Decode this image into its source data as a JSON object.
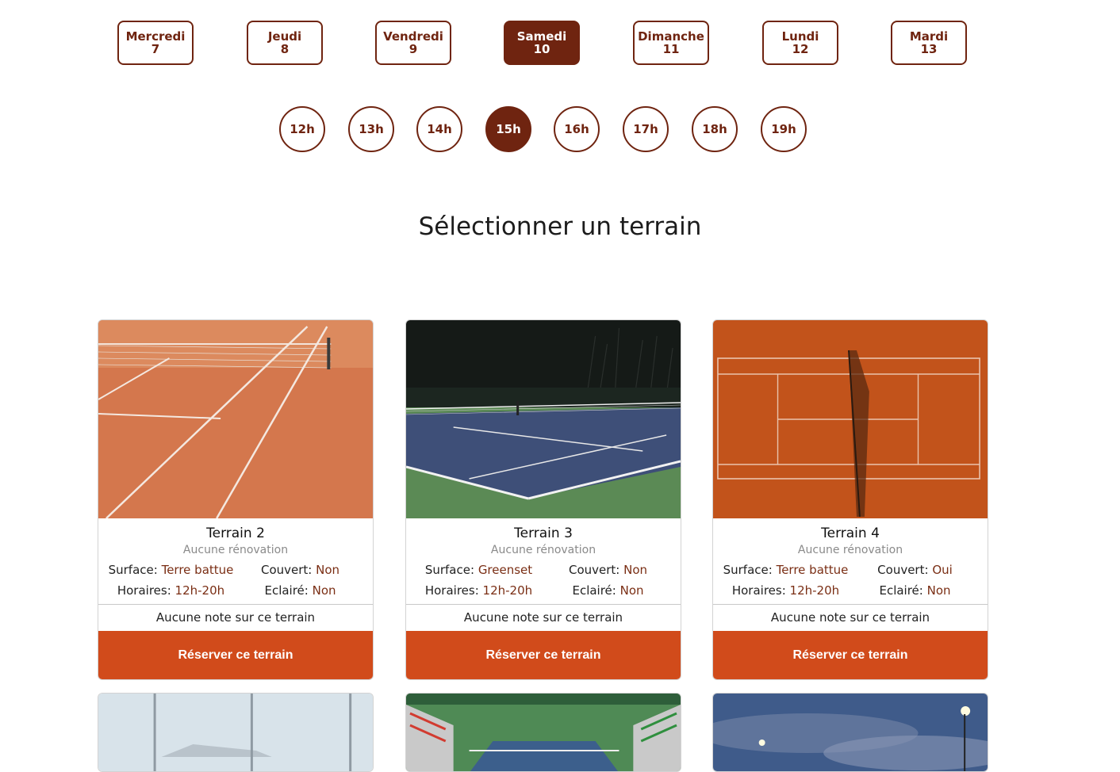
{
  "days": [
    {
      "name": "Mercredi",
      "num": "7",
      "active": false
    },
    {
      "name": "Jeudi",
      "num": "8",
      "active": false
    },
    {
      "name": "Vendredi",
      "num": "9",
      "active": false
    },
    {
      "name": "Samedi",
      "num": "10",
      "active": true
    },
    {
      "name": "Dimanche",
      "num": "11",
      "active": false
    },
    {
      "name": "Lundi",
      "num": "12",
      "active": false
    },
    {
      "name": "Mardi",
      "num": "13",
      "active": false
    }
  ],
  "hours": [
    {
      "label": "12h",
      "active": false
    },
    {
      "label": "13h",
      "active": false
    },
    {
      "label": "14h",
      "active": false
    },
    {
      "label": "15h",
      "active": true
    },
    {
      "label": "16h",
      "active": false
    },
    {
      "label": "17h",
      "active": false
    },
    {
      "label": "18h",
      "active": false
    },
    {
      "label": "19h",
      "active": false
    }
  ],
  "section_title": "Sélectionner un terrain",
  "labels": {
    "surface": "Surface:",
    "covered": "Couvert:",
    "hours": "Horaires:",
    "lit": "Eclairé:",
    "reserve": "Réserver ce terrain"
  },
  "courts": [
    {
      "name": "Terrain 2",
      "renovation": "Aucune rénovation",
      "surface": "Terre battue",
      "covered": "Non",
      "hours": "12h-20h",
      "lit": "Non",
      "rating": "Aucune note sur ce terrain"
    },
    {
      "name": "Terrain 3",
      "renovation": "Aucune rénovation",
      "surface": "Greenset",
      "covered": "Non",
      "hours": "12h-20h",
      "lit": "Non",
      "rating": "Aucune note sur ce terrain"
    },
    {
      "name": "Terrain 4",
      "renovation": "Aucune rénovation",
      "surface": "Terre battue",
      "covered": "Oui",
      "hours": "12h-20h",
      "lit": "Non",
      "rating": "Aucune note sur ce terrain"
    }
  ],
  "colors": {
    "brand_dark": "#6f2410",
    "accent_orange": "#d14b1b",
    "value_text": "#7a2e14"
  }
}
